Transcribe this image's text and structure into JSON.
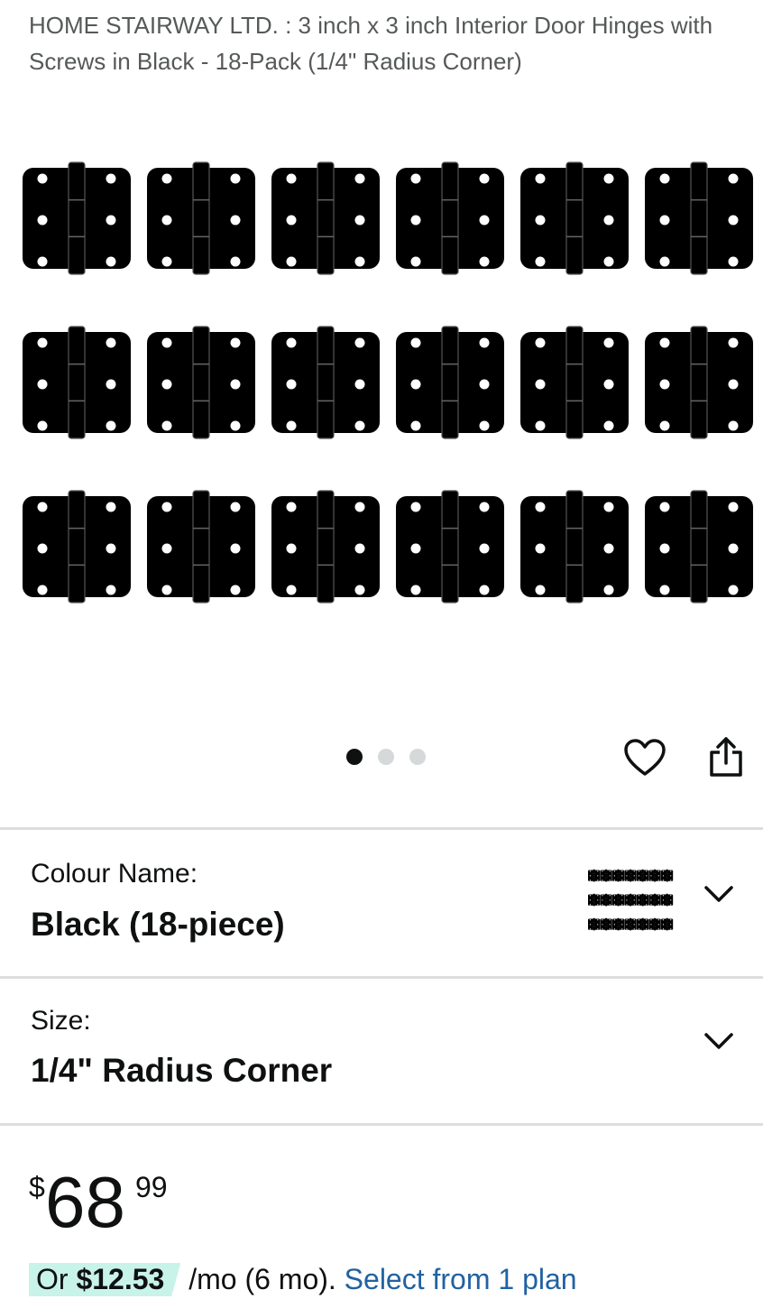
{
  "product": {
    "title": "HOME STAIRWAY LTD. : 3 inch x 3 inch Interior Door Hinges with Screws in Black - 18-Pack (1/4\" Radius Corner)"
  },
  "gallery": {
    "image_count": 3,
    "active_index": 0,
    "hinge_rows": 3,
    "hinge_cols": 6,
    "hinge_color": "#000000"
  },
  "actions": {
    "wishlist_icon": "heart-icon",
    "share_icon": "share-icon"
  },
  "variants": {
    "colour": {
      "label": "Colour Name:",
      "value": "Black (18-piece)"
    },
    "size": {
      "label": "Size:",
      "value": "1/4\" Radius Corner"
    }
  },
  "price": {
    "symbol": "$",
    "whole": "68",
    "fraction": "99"
  },
  "installment": {
    "prefix": "Or ",
    "amount": "$12.53",
    "suffix": " /mo (6 mo). ",
    "link": "Select from 1 plan",
    "badge_color": "#c8f3e8",
    "link_color": "#2162a1"
  }
}
